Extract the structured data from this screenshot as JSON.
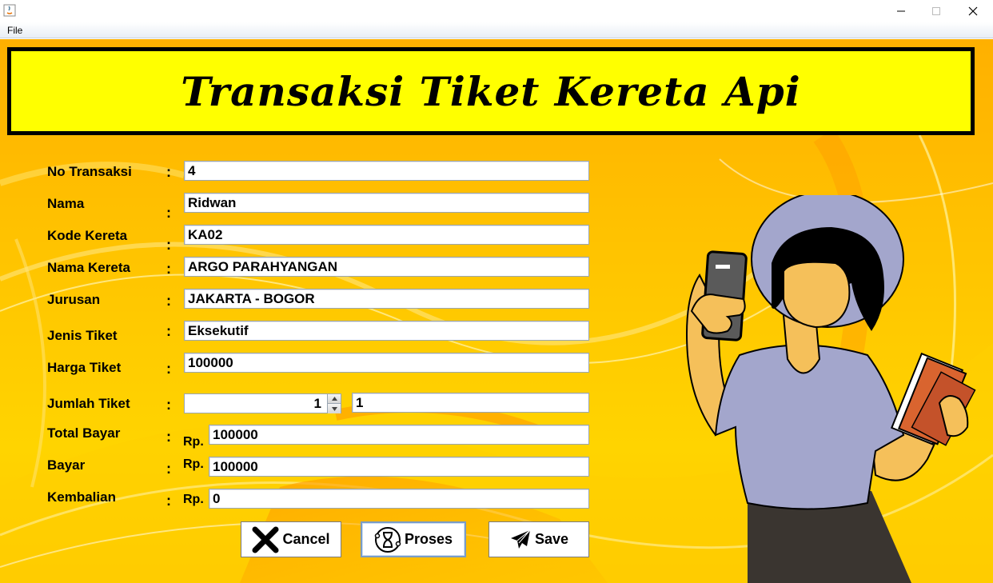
{
  "window": {
    "title": "",
    "menu": [
      "File"
    ]
  },
  "banner": {
    "title": "Transaksi Tiket Kereta Api"
  },
  "form": {
    "no_transaksi": {
      "label": "No Transaksi",
      "value": "4"
    },
    "nama": {
      "label": "Nama",
      "value": "Ridwan"
    },
    "kode_kereta": {
      "label": "Kode Kereta",
      "value": "KA02"
    },
    "nama_kereta": {
      "label": "Nama Kereta",
      "value": "ARGO PARAHYANGAN"
    },
    "jurusan": {
      "label": "Jurusan",
      "value": "JAKARTA - BOGOR"
    },
    "jenis_tiket": {
      "label": "Jenis Tiket",
      "value": "Eksekutif"
    },
    "harga_tiket": {
      "label": "Harga Tiket",
      "value": "100000"
    },
    "jumlah_tiket": {
      "label": "Jumlah Tiket",
      "spinner_value": "1",
      "value": "1"
    },
    "total_bayar": {
      "label": "Total Bayar",
      "prefix": "Rp.",
      "value": "100000"
    },
    "bayar": {
      "label": "Bayar",
      "prefix": "Rp.",
      "value": "100000"
    },
    "kembalian": {
      "label": "Kembalian",
      "prefix": "Rp.",
      "value": "0"
    },
    "colon": ":"
  },
  "buttons": {
    "cancel": {
      "label": "Cancel",
      "icon": "x-icon"
    },
    "proses": {
      "label": "Proses",
      "icon": "hourglass-icon"
    },
    "save": {
      "label": "Save",
      "icon": "paper-plane-icon"
    }
  },
  "colors": {
    "banner_bg": "#ffff00",
    "background": "#ffc400",
    "shirt": "#a3a6cc",
    "skin": "#f5c05a"
  }
}
